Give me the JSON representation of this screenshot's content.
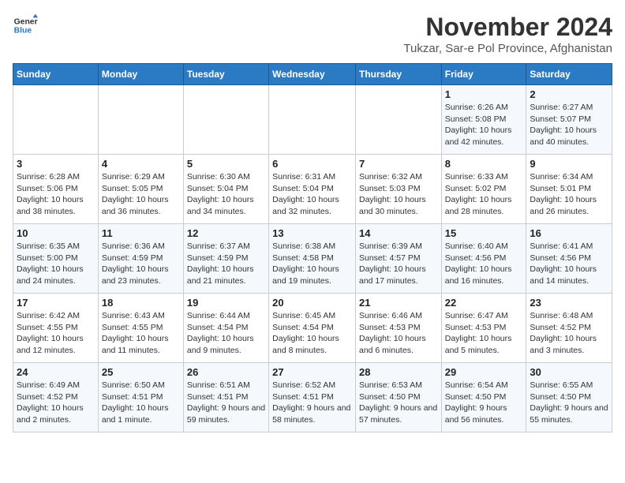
{
  "logo": {
    "line1": "General",
    "line2": "Blue"
  },
  "header": {
    "month": "November 2024",
    "location": "Tukzar, Sar-e Pol Province, Afghanistan"
  },
  "weekdays": [
    "Sunday",
    "Monday",
    "Tuesday",
    "Wednesday",
    "Thursday",
    "Friday",
    "Saturday"
  ],
  "weeks": [
    [
      {
        "day": "",
        "info": ""
      },
      {
        "day": "",
        "info": ""
      },
      {
        "day": "",
        "info": ""
      },
      {
        "day": "",
        "info": ""
      },
      {
        "day": "",
        "info": ""
      },
      {
        "day": "1",
        "info": "Sunrise: 6:26 AM\nSunset: 5:08 PM\nDaylight: 10 hours and 42 minutes."
      },
      {
        "day": "2",
        "info": "Sunrise: 6:27 AM\nSunset: 5:07 PM\nDaylight: 10 hours and 40 minutes."
      }
    ],
    [
      {
        "day": "3",
        "info": "Sunrise: 6:28 AM\nSunset: 5:06 PM\nDaylight: 10 hours and 38 minutes."
      },
      {
        "day": "4",
        "info": "Sunrise: 6:29 AM\nSunset: 5:05 PM\nDaylight: 10 hours and 36 minutes."
      },
      {
        "day": "5",
        "info": "Sunrise: 6:30 AM\nSunset: 5:04 PM\nDaylight: 10 hours and 34 minutes."
      },
      {
        "day": "6",
        "info": "Sunrise: 6:31 AM\nSunset: 5:04 PM\nDaylight: 10 hours and 32 minutes."
      },
      {
        "day": "7",
        "info": "Sunrise: 6:32 AM\nSunset: 5:03 PM\nDaylight: 10 hours and 30 minutes."
      },
      {
        "day": "8",
        "info": "Sunrise: 6:33 AM\nSunset: 5:02 PM\nDaylight: 10 hours and 28 minutes."
      },
      {
        "day": "9",
        "info": "Sunrise: 6:34 AM\nSunset: 5:01 PM\nDaylight: 10 hours and 26 minutes."
      }
    ],
    [
      {
        "day": "10",
        "info": "Sunrise: 6:35 AM\nSunset: 5:00 PM\nDaylight: 10 hours and 24 minutes."
      },
      {
        "day": "11",
        "info": "Sunrise: 6:36 AM\nSunset: 4:59 PM\nDaylight: 10 hours and 23 minutes."
      },
      {
        "day": "12",
        "info": "Sunrise: 6:37 AM\nSunset: 4:59 PM\nDaylight: 10 hours and 21 minutes."
      },
      {
        "day": "13",
        "info": "Sunrise: 6:38 AM\nSunset: 4:58 PM\nDaylight: 10 hours and 19 minutes."
      },
      {
        "day": "14",
        "info": "Sunrise: 6:39 AM\nSunset: 4:57 PM\nDaylight: 10 hours and 17 minutes."
      },
      {
        "day": "15",
        "info": "Sunrise: 6:40 AM\nSunset: 4:56 PM\nDaylight: 10 hours and 16 minutes."
      },
      {
        "day": "16",
        "info": "Sunrise: 6:41 AM\nSunset: 4:56 PM\nDaylight: 10 hours and 14 minutes."
      }
    ],
    [
      {
        "day": "17",
        "info": "Sunrise: 6:42 AM\nSunset: 4:55 PM\nDaylight: 10 hours and 12 minutes."
      },
      {
        "day": "18",
        "info": "Sunrise: 6:43 AM\nSunset: 4:55 PM\nDaylight: 10 hours and 11 minutes."
      },
      {
        "day": "19",
        "info": "Sunrise: 6:44 AM\nSunset: 4:54 PM\nDaylight: 10 hours and 9 minutes."
      },
      {
        "day": "20",
        "info": "Sunrise: 6:45 AM\nSunset: 4:54 PM\nDaylight: 10 hours and 8 minutes."
      },
      {
        "day": "21",
        "info": "Sunrise: 6:46 AM\nSunset: 4:53 PM\nDaylight: 10 hours and 6 minutes."
      },
      {
        "day": "22",
        "info": "Sunrise: 6:47 AM\nSunset: 4:53 PM\nDaylight: 10 hours and 5 minutes."
      },
      {
        "day": "23",
        "info": "Sunrise: 6:48 AM\nSunset: 4:52 PM\nDaylight: 10 hours and 3 minutes."
      }
    ],
    [
      {
        "day": "24",
        "info": "Sunrise: 6:49 AM\nSunset: 4:52 PM\nDaylight: 10 hours and 2 minutes."
      },
      {
        "day": "25",
        "info": "Sunrise: 6:50 AM\nSunset: 4:51 PM\nDaylight: 10 hours and 1 minute."
      },
      {
        "day": "26",
        "info": "Sunrise: 6:51 AM\nSunset: 4:51 PM\nDaylight: 9 hours and 59 minutes."
      },
      {
        "day": "27",
        "info": "Sunrise: 6:52 AM\nSunset: 4:51 PM\nDaylight: 9 hours and 58 minutes."
      },
      {
        "day": "28",
        "info": "Sunrise: 6:53 AM\nSunset: 4:50 PM\nDaylight: 9 hours and 57 minutes."
      },
      {
        "day": "29",
        "info": "Sunrise: 6:54 AM\nSunset: 4:50 PM\nDaylight: 9 hours and 56 minutes."
      },
      {
        "day": "30",
        "info": "Sunrise: 6:55 AM\nSunset: 4:50 PM\nDaylight: 9 hours and 55 minutes."
      }
    ]
  ]
}
